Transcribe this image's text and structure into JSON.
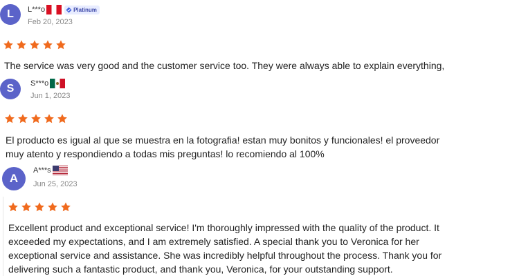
{
  "colors": {
    "star": "#f06a1d",
    "avatar": "#5b63c9",
    "date": "#888888"
  },
  "reviews": [
    {
      "avatar_letter": "L",
      "name": "L***o",
      "flag_icon": "peru-flag-icon",
      "badge": "Platinum",
      "date": "Feb 20, 2023",
      "rating": 5,
      "text_lines": [
        "The service was very good and the customer service too. They were always able to explain everything,"
      ]
    },
    {
      "avatar_letter": "S",
      "name": "S***o",
      "flag_icon": "mexico-flag-icon",
      "date": "Jun 1, 2023",
      "rating": 5,
      "text_lines": [
        "El producto es igual al que se muestra en la fotografia! estan muy bonitos y funcionales! el proveedor",
        "muy atento y respondiendo a todas mis preguntas! lo recomiendo al 100%"
      ]
    },
    {
      "avatar_letter": "A",
      "name": "A***s",
      "flag_icon": "usa-flag-icon",
      "date": "Jun 25, 2023",
      "rating": 5,
      "text_lines": [
        "Excellent product and exceptional service! I'm thoroughly impressed with the quality of the product. It",
        "exceeded my expectations, and I am extremely satisfied. A special thank you to Veronica for her",
        "exceptional service and assistance. She was incredibly helpful throughout the process. Thank you for",
        "delivering such a fantastic product, and thank you, Veronica, for your outstanding support."
      ]
    }
  ]
}
